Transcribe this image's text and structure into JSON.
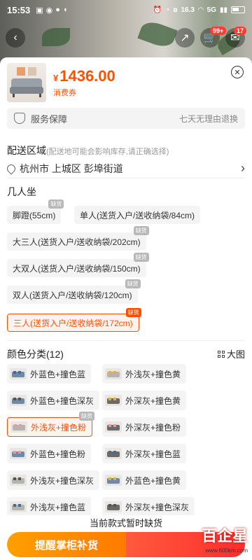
{
  "status_bar": {
    "time": "15:53",
    "left_icons": [
      "notification-icon",
      "pin-icon",
      "chat-icon",
      "bubble-icon"
    ],
    "right_icons": [
      "alarm-icon",
      "clock-icon",
      "bluetooth-icon",
      "data-rate-icon",
      "wifi-icon",
      "signal-5g-icon",
      "signal-icon",
      "battery-icon"
    ],
    "net_speed": "16.3"
  },
  "top_nav": {
    "back_icon": "chevron-left-icon",
    "share_icon": "share-icon",
    "cart_badge": "99+",
    "msg_badge": "17"
  },
  "product": {
    "currency": "¥",
    "price": "1436.00",
    "coupon_label": "消费券"
  },
  "service": {
    "label": "服务保障",
    "value": "七天无理由退换"
  },
  "delivery": {
    "title": "配送区域",
    "note": "(配送地可能会影响库存,请正确选择)",
    "location": "杭州市 上城区 彭埠街道"
  },
  "seats": {
    "title": "几人坐",
    "options": [
      {
        "label": "脚蹬(55cm)",
        "tag": "缺货"
      },
      {
        "label": "单人(送货入户/送收纳袋/84cm)",
        "tag": ""
      },
      {
        "label": "大三人(送货入户/送收纳袋/202cm)",
        "tag": "缺货"
      },
      {
        "label": "大双人(送货入户/送收纳袋/150cm)",
        "tag": "缺货"
      },
      {
        "label": "双人(送货入户/送收纳袋/120cm)",
        "tag": "缺货"
      },
      {
        "label": "三人(送货入户/送收纳袋/172cm)",
        "tag": "缺货",
        "selected": true
      }
    ]
  },
  "colors": {
    "title": "颜色分类(12)",
    "big_image_label": "大图",
    "options": [
      {
        "label": "外蓝色+撞色蓝",
        "tag": "",
        "main": "#6e8aa8",
        "accent": "#4a6a90"
      },
      {
        "label": "外浅灰+撞色黄",
        "tag": "",
        "main": "#b5b5b0",
        "accent": "#e0b040"
      },
      {
        "label": "外蓝色+撞色深灰",
        "tag": "",
        "main": "#6e8aa8",
        "accent": "#555555"
      },
      {
        "label": "外深灰+撞色黄",
        "tag": "",
        "main": "#6a6a6a",
        "accent": "#e0b040"
      },
      {
        "label": "外浅灰+撞色粉",
        "tag": "缺货",
        "selected": true,
        "main": "#b5b5b0",
        "accent": "#e89aa8"
      },
      {
        "label": "外深灰+撞色粉",
        "tag": "",
        "main": "#6a6a6a",
        "accent": "#e89aa8"
      },
      {
        "label": "外蓝色+撞色粉",
        "tag": "",
        "main": "#6e8aa8",
        "accent": "#e89aa8"
      },
      {
        "label": "外深灰+撞色蓝",
        "tag": "",
        "main": "#6a6a6a",
        "accent": "#4a6a90"
      },
      {
        "label": "外浅灰+撞色深灰",
        "tag": "",
        "main": "#b5b5b0",
        "accent": "#555555"
      },
      {
        "label": "外蓝色+撞色黄",
        "tag": "",
        "main": "#6e8aa8",
        "accent": "#e0b040"
      },
      {
        "label": "外浅灰+撞色蓝",
        "tag": "",
        "main": "#b5b5b0",
        "accent": "#4a6a90"
      },
      {
        "label": "外深灰+撞色深灰",
        "tag": "",
        "main": "#6a6a6a",
        "accent": "#555555"
      }
    ]
  },
  "footer": {
    "out_of_stock": "当前款式暂时缺货",
    "remind_button": "提醒掌柜补货"
  },
  "watermark": {
    "logo": "百企星",
    "url": "www.600km.com"
  },
  "theme": {
    "accent": "#ff5000",
    "chip_bg": "#f4f4f4"
  }
}
